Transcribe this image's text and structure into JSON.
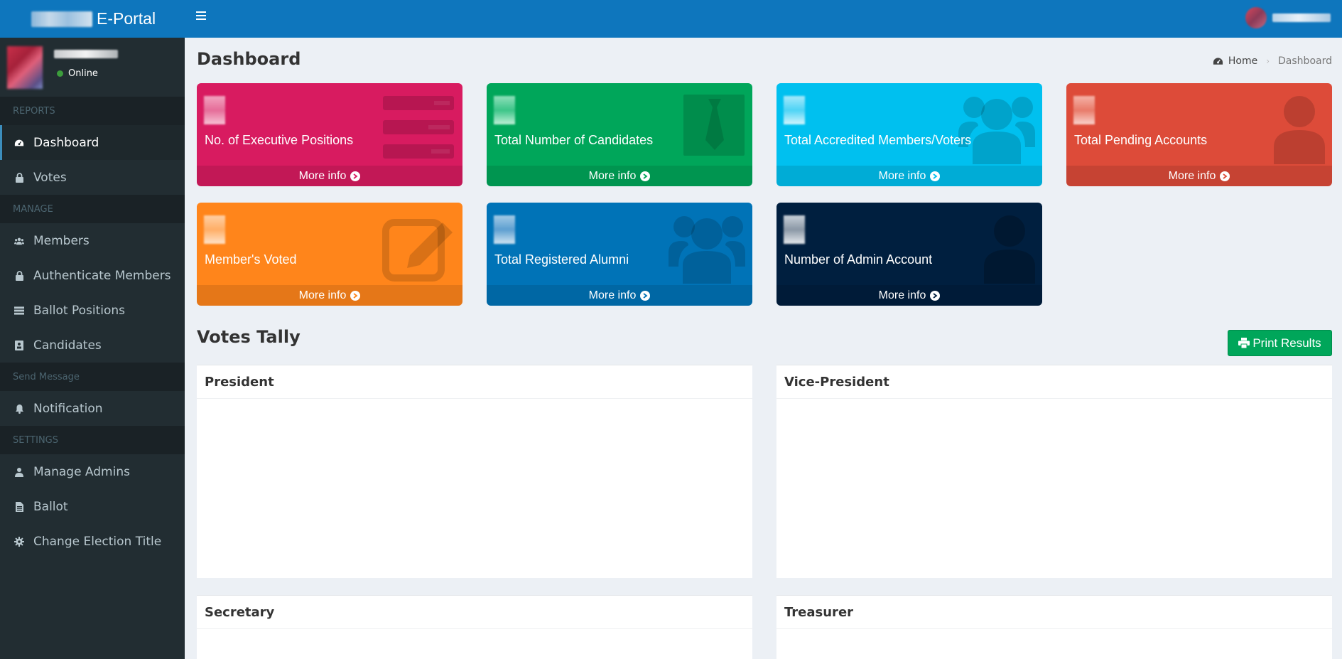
{
  "app": {
    "logo_text": "E-Portal"
  },
  "sidebar": {
    "status": "Online",
    "sections": [
      {
        "header": "REPORTS",
        "items": [
          "Dashboard",
          "Votes"
        ]
      },
      {
        "header": "MANAGE",
        "items": [
          "Members",
          "Authenticate Members",
          "Ballot Positions",
          "Candidates"
        ]
      },
      {
        "header": "Send Message",
        "items": [
          "Notification"
        ]
      },
      {
        "header": "SETTINGS",
        "items": [
          "Manage Admins",
          "Ballot",
          "Change Election Title"
        ]
      }
    ],
    "icons": {
      "Dashboard": "dashboard-icon",
      "Votes": "lock-icon",
      "Members": "users-icon",
      "Authenticate Members": "lock-icon",
      "Ballot Positions": "tasks-icon",
      "Candidates": "id-card-icon",
      "Notification": "bell-icon",
      "Manage Admins": "user-icon",
      "Ballot": "file-icon",
      "Change Election Title": "cog-icon"
    },
    "active": "Dashboard"
  },
  "header": {
    "page_title": "Dashboard",
    "breadcrumb_home": "Home",
    "breadcrumb_current": "Dashboard"
  },
  "stat_boxes": [
    {
      "label": "No. of Executive Positions",
      "more": "More info",
      "color": "#d81b60",
      "icon": "list-icon"
    },
    {
      "label": "Total Number of Candidates",
      "more": "More info",
      "color": "#00a65a",
      "icon": "tie-icon"
    },
    {
      "label": "Total Accredited Members/Voters",
      "more": "More info",
      "color": "#00c0ef",
      "icon": "users-icon"
    },
    {
      "label": "Total Pending Accounts",
      "more": "More info",
      "color": "#dd4b39",
      "icon": "user-icon"
    },
    {
      "label": "Member's Voted",
      "more": "More info",
      "color": "#ff851b",
      "icon": "edit-icon"
    },
    {
      "label": "Total Registered Alumni",
      "more": "More info",
      "color": "#0073b7",
      "icon": "users-icon"
    },
    {
      "label": "Number of Admin Account",
      "more": "More info",
      "color": "#001f3f",
      "icon": "user-icon"
    }
  ],
  "votes_tally": {
    "title": "Votes Tally",
    "print_button": "Print Results",
    "panels": [
      "President",
      "Vice-President",
      "Secretary",
      "Treasurer"
    ]
  }
}
